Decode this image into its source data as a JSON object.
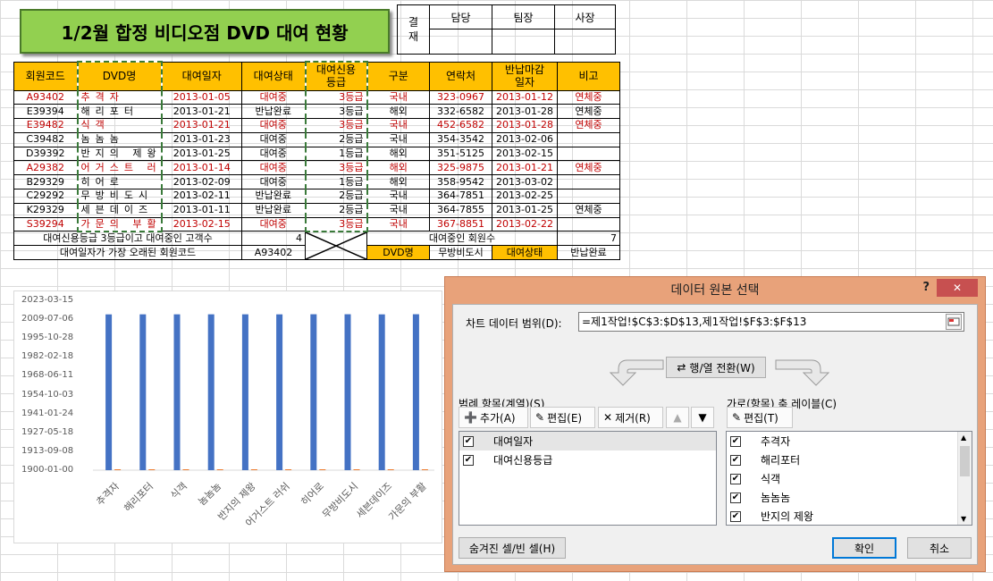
{
  "title": "1/2월 합정 비디오점 DVD 대여 현황",
  "approval": {
    "side": "결재",
    "headers": [
      "담당",
      "팀장",
      "사장"
    ]
  },
  "table": {
    "headers": [
      "회원코드",
      "DVD명",
      "대여일자",
      "대여상태",
      "대여신용등급",
      "구분",
      "연락처",
      "반납마감일자",
      "비고"
    ],
    "rows": [
      {
        "code": "A93402",
        "dvd": "추격자",
        "date": "2013-01-05",
        "status": "대여중",
        "grade": "3등급",
        "kind": "국내",
        "phone": "323-0967",
        "due": "2013-01-12",
        "note": "연체중",
        "red": true
      },
      {
        "code": "E39394",
        "dvd": "해리포터",
        "date": "2013-01-21",
        "status": "반납완료",
        "grade": "3등급",
        "kind": "해외",
        "phone": "332-6582",
        "due": "2013-01-28",
        "note": "연체중",
        "red": false
      },
      {
        "code": "E39482",
        "dvd": "식객",
        "date": "2013-01-21",
        "status": "대여중",
        "grade": "3등급",
        "kind": "국내",
        "phone": "452-6582",
        "due": "2013-01-28",
        "note": "연체중",
        "red": true
      },
      {
        "code": "C39482",
        "dvd": "놈놈놈",
        "date": "2013-01-23",
        "status": "대여중",
        "grade": "2등급",
        "kind": "국내",
        "phone": "354-3542",
        "due": "2013-02-06",
        "note": "",
        "red": false
      },
      {
        "code": "D39392",
        "dvd": "반지의 제왕",
        "date": "2013-01-25",
        "status": "대여중",
        "grade": "1등급",
        "kind": "해외",
        "phone": "351-5125",
        "due": "2013-02-15",
        "note": "",
        "red": false
      },
      {
        "code": "A29382",
        "dvd": "어거스트 러쉬",
        "date": "2013-01-14",
        "status": "대여중",
        "grade": "3등급",
        "kind": "해외",
        "phone": "325-9875",
        "due": "2013-01-21",
        "note": "연체중",
        "red": true
      },
      {
        "code": "B29329",
        "dvd": "히어로",
        "date": "2013-02-09",
        "status": "대여중",
        "grade": "1등급",
        "kind": "해외",
        "phone": "358-9542",
        "due": "2013-03-02",
        "note": "",
        "red": false
      },
      {
        "code": "C29292",
        "dvd": "무방비도시",
        "date": "2013-02-11",
        "status": "반납완료",
        "grade": "2등급",
        "kind": "국내",
        "phone": "364-7851",
        "due": "2013-02-25",
        "note": "",
        "red": false
      },
      {
        "code": "K29329",
        "dvd": "세븐데이즈",
        "date": "2013-01-11",
        "status": "반납완료",
        "grade": "2등급",
        "kind": "국내",
        "phone": "364-7855",
        "due": "2013-01-25",
        "note": "연체중",
        "red": false
      },
      {
        "code": "S39294",
        "dvd": "가문의 부활",
        "date": "2013-02-15",
        "status": "대여중",
        "grade": "3등급",
        "kind": "국내",
        "phone": "367-8851",
        "due": "2013-02-22",
        "note": "",
        "red": true
      }
    ],
    "summary1_label": "대여신용등급 3등급이고 대여중인 고객수",
    "summary1_value": "4",
    "summary2_label": "대여일자가 가장 오래된 회원코드",
    "summary2_value": "A93402",
    "summary3_label": "대여중인 회원수",
    "summary3_value": "7",
    "lookup_dvd_label": "DVD명",
    "lookup_dvd_value": "무방비도시",
    "lookup_status_label": "대여상태",
    "lookup_status_value": "반납완료"
  },
  "chart_data": {
    "type": "bar",
    "categories": [
      "추격자",
      "해리포터",
      "식객",
      "놈놈놈",
      "반지의 제왕",
      "어거스트 러쉬",
      "히어로",
      "무방비도시",
      "세븐데이즈",
      "가문의 부활"
    ],
    "series": [
      {
        "name": "대여일자",
        "values": [
          "2013-01-05",
          "2013-01-21",
          "2013-01-21",
          "2013-01-23",
          "2013-01-25",
          "2013-01-14",
          "2013-02-09",
          "2013-02-11",
          "2013-01-11",
          "2013-02-15"
        ],
        "color": "#4472c4"
      },
      {
        "name": "대여신용등급",
        "values": [
          3,
          3,
          3,
          2,
          1,
          3,
          1,
          2,
          2,
          3
        ],
        "color": "#ed7d31"
      }
    ],
    "yticks": [
      "2023-03-15",
      "2009-07-06",
      "1995-10-28",
      "1982-02-18",
      "1968-06-11",
      "1954-10-03",
      "1941-01-24",
      "1927-05-18",
      "1913-09-08",
      "1900-01-00"
    ],
    "grid": false
  },
  "dialog": {
    "title": "데이터 원본 선택",
    "help": "?",
    "close": "✕",
    "range_label": "차트 데이터 범위(D):",
    "range_value": "=제1작업!$C$3:$D$13,제1작업!$F$3:$F$13",
    "switch_button": "행/열 전환(W)",
    "legend_label": "범례 항목(계열)(S)",
    "add_button": "추가(A)",
    "edit_button": "편집(E)",
    "remove_button": "제거(R)",
    "series_items": [
      "대여일자",
      "대여신용등급"
    ],
    "axis_label": "가로(항목) 축 레이블(C)",
    "axis_edit_button": "편집(T)",
    "axis_items": [
      "추격자",
      "해리포터",
      "식객",
      "놈놈놈",
      "반지의 제왕"
    ],
    "hidden_button": "숨겨진 셀/빈 셀(H)",
    "ok_button": "확인",
    "cancel_button": "취소"
  }
}
